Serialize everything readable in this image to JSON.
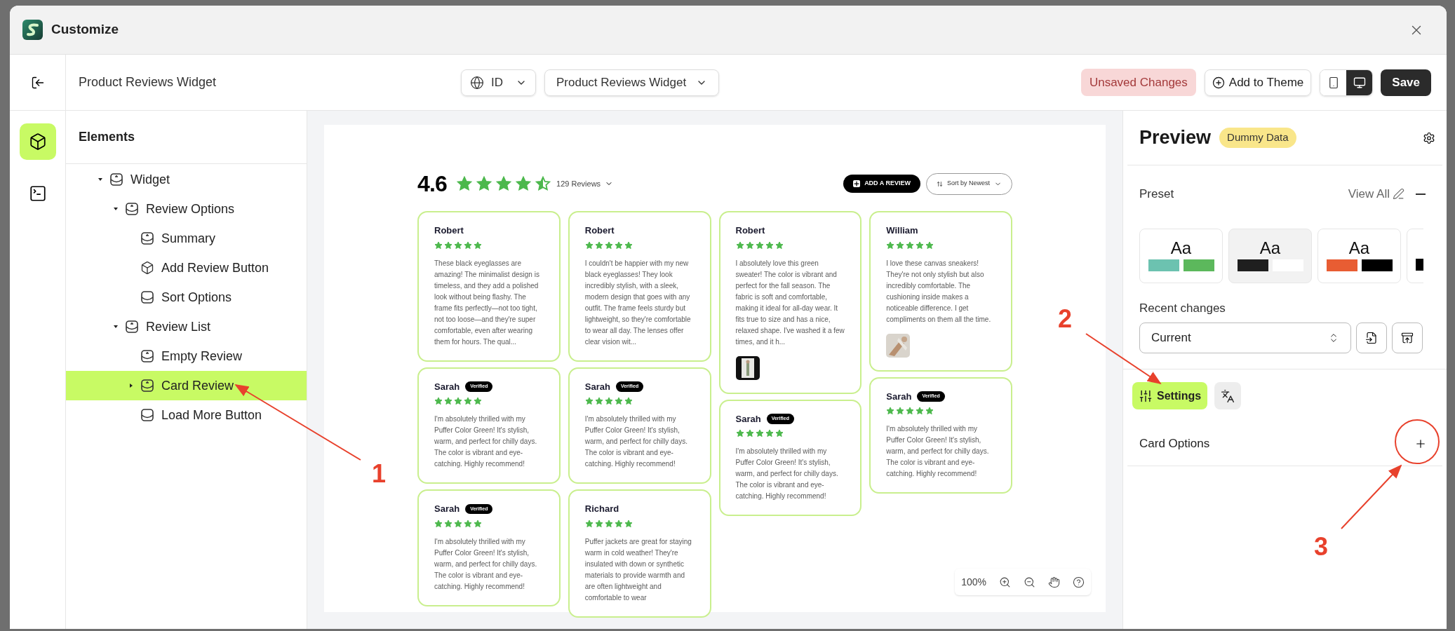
{
  "window": {
    "title": "Customize"
  },
  "toolbar": {
    "title": "Product Reviews Widget",
    "language": "ID",
    "widget_select": "Product Reviews Widget",
    "status": "Unsaved Changes",
    "add_button": "Add to Theme",
    "devices": [
      {
        "kind": "mobile",
        "selected": false
      },
      {
        "kind": "desktop",
        "selected": true
      }
    ],
    "save_button": "Save"
  },
  "rail": [
    {
      "kind": "elements",
      "selected": true
    },
    {
      "kind": "code",
      "selected": false
    }
  ],
  "elements": {
    "title": "Elements",
    "tree": [
      {
        "label": "Widget",
        "kind": "section",
        "expanded": true,
        "selected": false,
        "children": [
          {
            "label": "Review Options",
            "kind": "section",
            "expanded": true,
            "selected": false,
            "children": [
              {
                "label": "Summary",
                "kind": "section",
                "selected": false
              },
              {
                "label": "Add Review Button",
                "kind": "block",
                "selected": false
              },
              {
                "label": "Sort Options",
                "kind": "tray",
                "selected": false
              }
            ]
          },
          {
            "label": "Review List",
            "kind": "section",
            "expanded": true,
            "selected": false,
            "children": [
              {
                "label": "Empty Review",
                "kind": "section",
                "selected": false
              },
              {
                "label": "Card Review",
                "kind": "section",
                "expanded": false,
                "selected": true
              },
              {
                "label": "Load More Button",
                "kind": "tray",
                "selected": false
              }
            ]
          }
        ]
      }
    ]
  },
  "preview": {
    "rating": "4.6",
    "stars": 4.5,
    "count": "129 Reviews",
    "add_button": "ADD A REVIEW",
    "sort": "Sort by Newest",
    "columns": [
      [
        {
          "name": "Robert",
          "stars": 5,
          "text": "These black eyeglasses are amazing! The minimalist design is timeless, and they add a polished look without being flashy. The frame fits perfectly—not too tight, not too loose—and they're super comfortable, even after wearing them for hours. The qual..."
        },
        {
          "name": "Sarah",
          "badge": "Verified",
          "stars": 5,
          "text": "I'm absolutely thrilled with my Puffer Color Green! It's stylish, warm, and perfect for chilly days. The color is vibrant and eye-catching. Highly recommend!"
        },
        {
          "name": "Sarah",
          "badge": "Verified",
          "stars": 5,
          "text": "I'm absolutely thrilled with my Puffer Color Green! It's stylish, warm, and perfect for chilly days. The color is vibrant and eye-catching. Highly recommend!"
        }
      ],
      [
        {
          "name": "Robert",
          "stars": 5,
          "text": "I couldn't be happier with my new black eyeglasses! They look incredibly stylish, with a sleek, modern design that goes with any outfit. The frame feels sturdy but lightweight, so they're comfortable to wear all day. The lenses offer clear vision wit..."
        },
        {
          "name": "Sarah",
          "badge": "Verified",
          "stars": 5,
          "text": "I'm absolutely thrilled with my Puffer Color Green! It's stylish, warm, and perfect for chilly days. The color is vibrant and eye-catching. Highly recommend!"
        },
        {
          "name": "Richard",
          "stars": 5,
          "text": "Puffer jackets are great for staying warm in cold weather! They're insulated with down or synthetic materials to provide warmth and are often lightweight and comfortable to wear"
        }
      ],
      [
        {
          "name": "Robert",
          "stars": 5,
          "text": "I absolutely love this green sweater! The color is vibrant and perfect for the fall season. The fabric is soft and comfortable, making it ideal for all-day wear. It fits true to size and has a nice, relaxed shape. I've washed it a few times, and it h...",
          "photo": true
        },
        {
          "name": "Sarah",
          "badge": "Verified",
          "stars": 5,
          "text": "I'm absolutely thrilled with my Puffer Color Green! It's stylish, warm, and perfect for chilly days. The color is vibrant and eye-catching. Highly recommend!"
        }
      ],
      [
        {
          "name": "William",
          "stars": 5,
          "text": "I love these canvas sneakers! They're not only stylish but also incredibly comfortable. The cushioning inside makes a noticeable difference. I get compliments on them all the time.",
          "photo": true
        },
        {
          "name": "Sarah",
          "badge": "Verified",
          "stars": 5,
          "text": "I'm absolutely thrilled with my Puffer Color Green! It's stylish, warm, and perfect for chilly days. The color is vibrant and eye-catching. Highly recommend!"
        }
      ]
    ],
    "zoom": "100%"
  },
  "panel": {
    "title": "Preview",
    "badge": "Dummy Data",
    "preset_label": "Preset",
    "view_all": "View All",
    "presets": [
      {
        "sample": "Aa",
        "swatches": [
          {
            "color": "#6cc2b0"
          },
          {
            "color": "#5cb85c"
          }
        ],
        "selected": false
      },
      {
        "sample": "Aa",
        "swatches": [
          {
            "color": "#1f1f1f"
          },
          {
            "color": "#ffffff"
          }
        ],
        "selected": true
      },
      {
        "sample": "Aa",
        "swatches": [
          {
            "color": "#e85d33"
          },
          {
            "color": "#000000"
          }
        ],
        "selected": false
      },
      {
        "swatches": [
          {
            "color": "#000000"
          }
        ],
        "selected": false
      }
    ],
    "recent_label": "Recent changes",
    "recent_value": "Current",
    "tabs": [
      {
        "kind": "settings",
        "label": "Settings",
        "selected": true
      },
      {
        "kind": "translate",
        "selected": false
      }
    ],
    "section": "Card Options"
  },
  "annotations": [
    {
      "label": "1"
    },
    {
      "label": "2"
    },
    {
      "label": "3"
    }
  ]
}
